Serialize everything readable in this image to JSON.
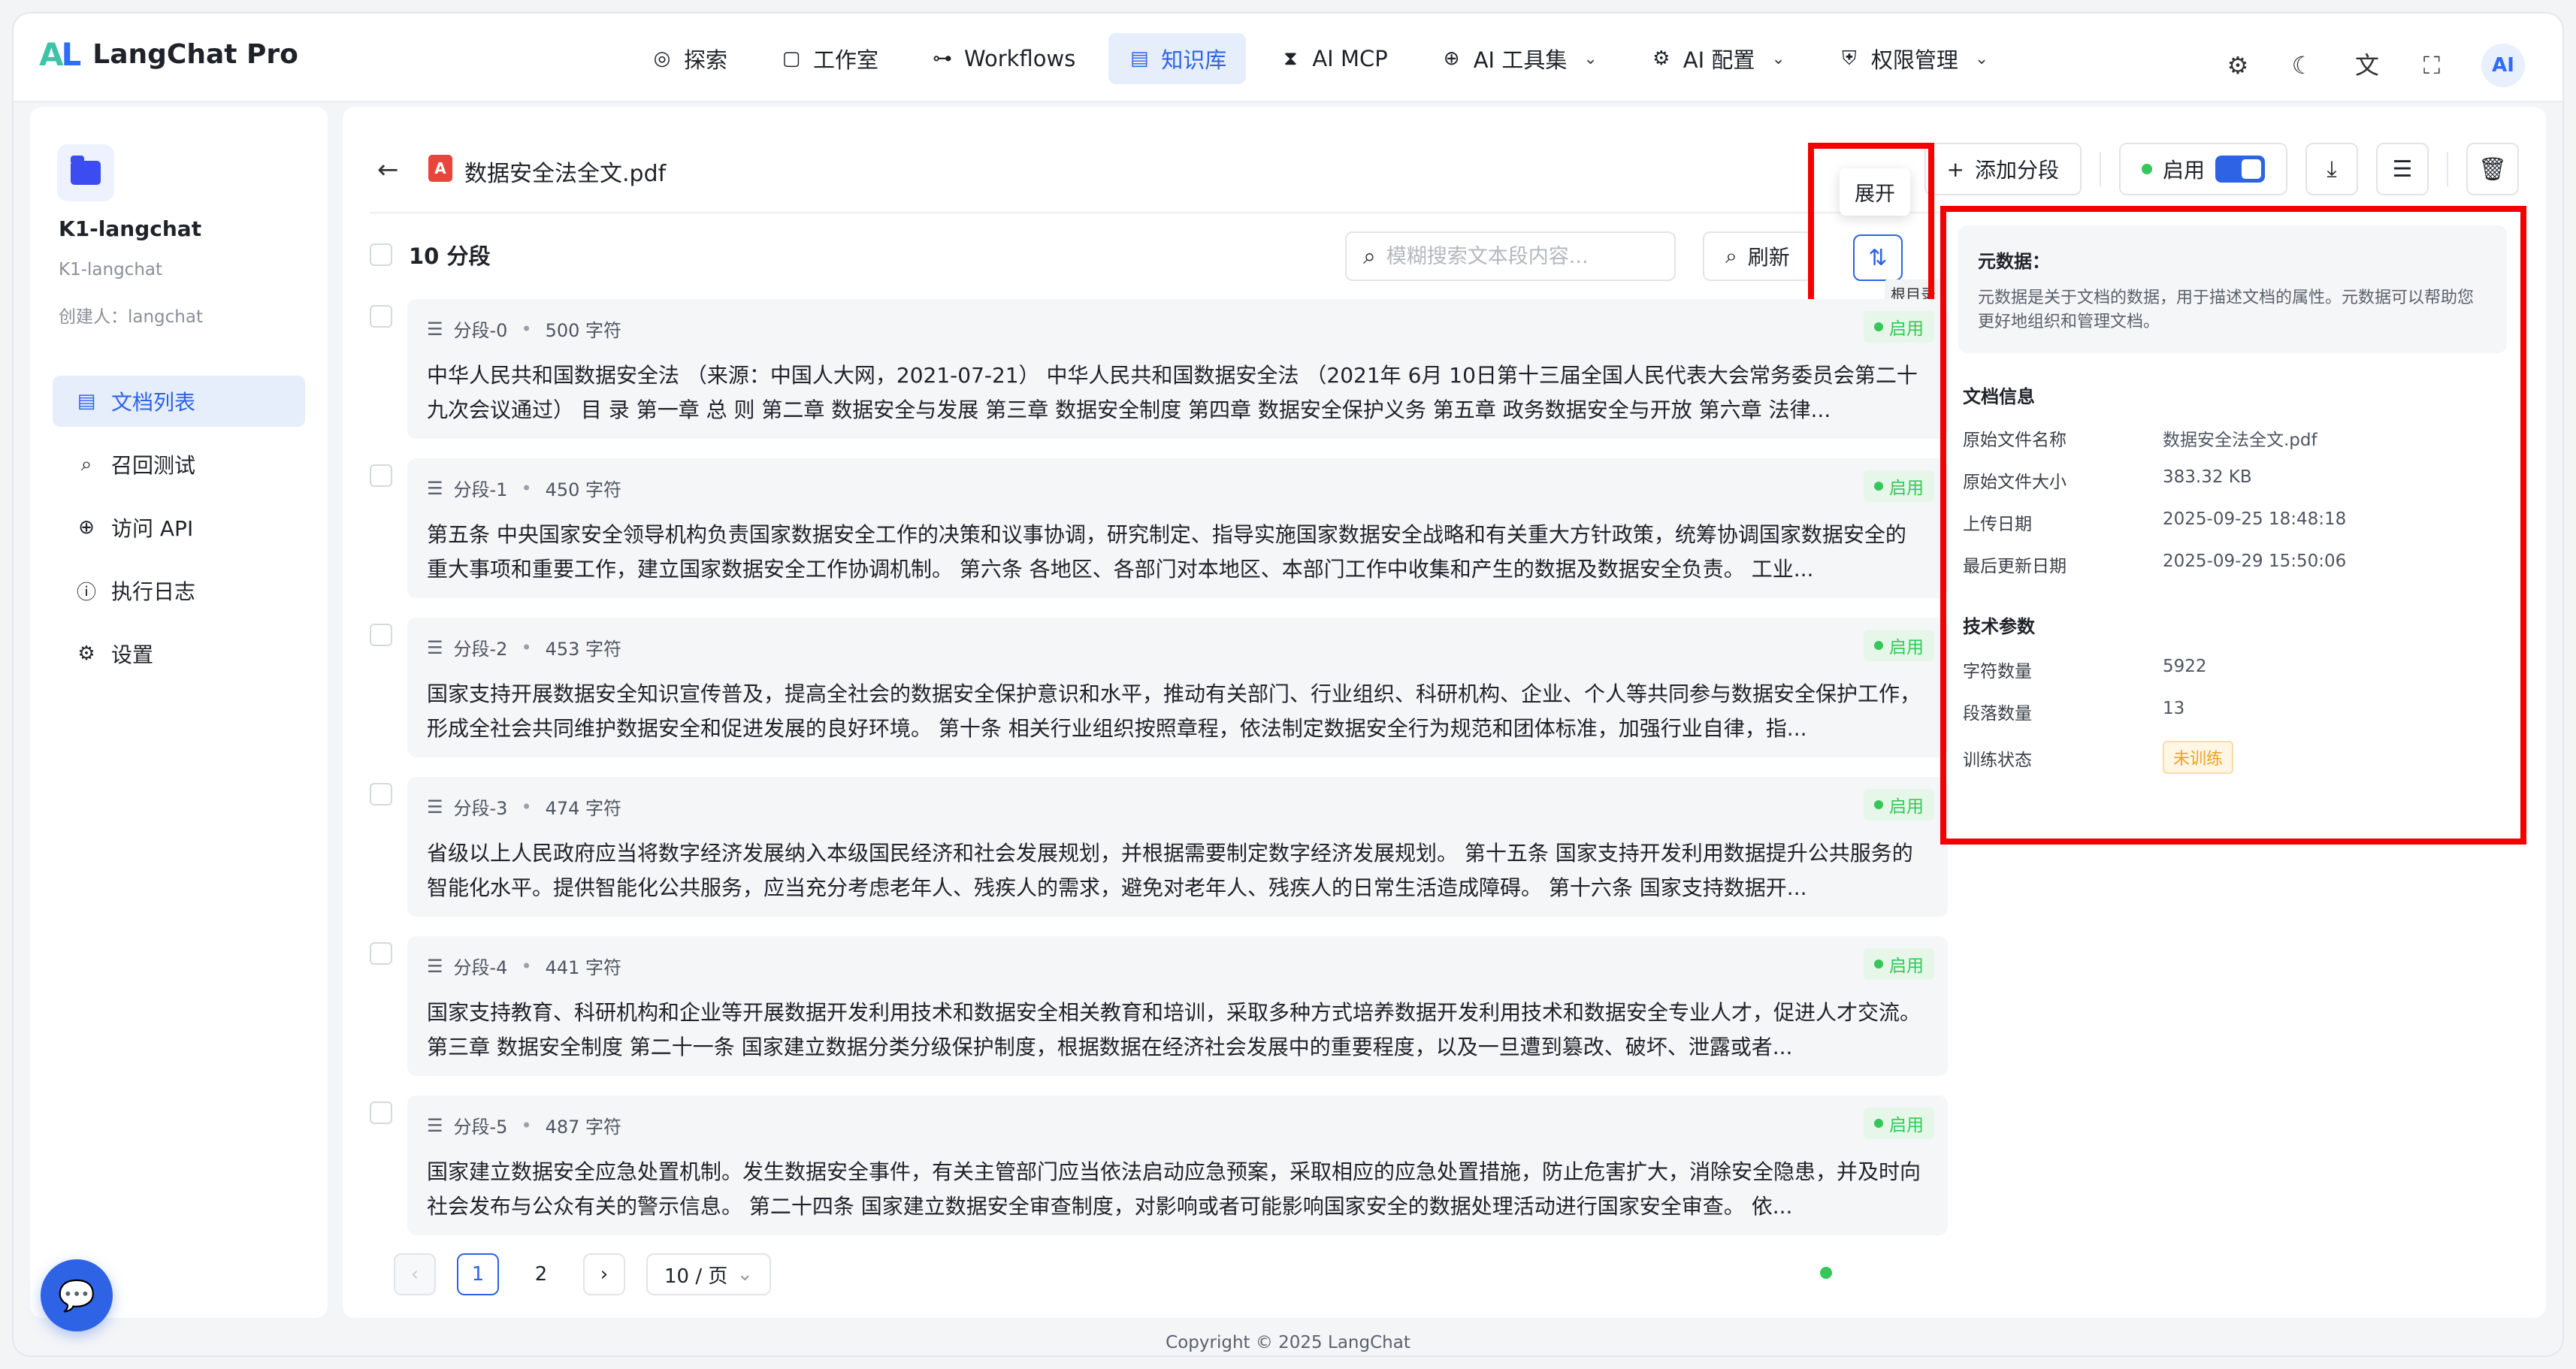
{
  "app": {
    "name": "LangChat Pro",
    "logo_a": "A",
    "logo_l": "L"
  },
  "nav": [
    {
      "icon": "◎",
      "label": "探索",
      "caret": ""
    },
    {
      "icon": "▢",
      "label": "工作室",
      "caret": ""
    },
    {
      "icon": "⊶",
      "label": "Workflows",
      "caret": ""
    },
    {
      "icon": "▤",
      "label": "知识库",
      "caret": ""
    },
    {
      "icon": "⧗",
      "label": "AI MCP",
      "caret": ""
    },
    {
      "icon": "⊕",
      "label": "AI 工具集",
      "caret": "⌄"
    },
    {
      "icon": "⚙",
      "label": "AI 配置",
      "caret": "⌄"
    },
    {
      "icon": "⛨",
      "label": "权限管理",
      "caret": "⌄"
    }
  ],
  "tools": {
    "settings": "⚙",
    "theme": "☾",
    "lang": "文",
    "fullscreen": "⛶",
    "avatar": "AI"
  },
  "kb": {
    "name": "K1-langchat",
    "sub": "K1-langchat",
    "creator": "创建人：langchat"
  },
  "side_menu": [
    {
      "icon": "▤",
      "label": "文档列表"
    },
    {
      "icon": "⌕",
      "label": "召回测试"
    },
    {
      "icon": "⊕",
      "label": "访问 API"
    },
    {
      "icon": "ⓘ",
      "label": "执行日志"
    },
    {
      "icon": "⚙",
      "label": "设置"
    }
  ],
  "doc": {
    "back": "←",
    "pdf_icon": "A",
    "title": "数据安全法全文.pdf",
    "add_segment": "添加分段",
    "add_icon": "+",
    "enable": "启用",
    "download_icon": "⤓",
    "settings_icon": "☰",
    "delete_icon": "🗑"
  },
  "toolbar": {
    "count": "10 分段",
    "search_placeholder": "模糊搜索文本段内容...",
    "search_icon": "⌕",
    "refresh": "刷新",
    "expand_icon": "⇅",
    "tooltip": "展开",
    "tooltip_small": "根目录"
  },
  "segments": [
    {
      "title": "分段-0",
      "chars": "500 字符",
      "status": "启用",
      "text": "中华人民共和国数据安全法 （来源：中国人大网，2021-07-21） 中华人民共和国数据安全法 （2021年 6月 10日第十三届全国人民代表大会常务委员会第二十九次会议通过） 目 录 第一章 总 则 第二章 数据安全与发展 第三章 数据安全制度 第四章 数据安全保护义务 第五章 政务数据安全与开放 第六章 法律..."
    },
    {
      "title": "分段-1",
      "chars": "450 字符",
      "status": "启用",
      "text": "第五条 中央国家安全领导机构负责国家数据安全工作的决策和议事协调，研究制定、指导实施国家数据安全战略和有关重大方针政策，统筹协调国家数据安全的重大事项和重要工作，建立国家数据安全工作协调机制。 第六条 各地区、各部门对本地区、本部门工作中收集和产生的数据及数据安全负责。 工业..."
    },
    {
      "title": "分段-2",
      "chars": "453 字符",
      "status": "启用",
      "text": "国家支持开展数据安全知识宣传普及，提高全社会的数据安全保护意识和水平，推动有关部门、行业组织、科研机构、企业、个人等共同参与数据安全保护工作，形成全社会共同维护数据安全和促进发展的良好环境。 第十条 相关行业组织按照章程，依法制定数据安全行为规范和团体标准，加强行业自律，指..."
    },
    {
      "title": "分段-3",
      "chars": "474 字符",
      "status": "启用",
      "text": "省级以上人民政府应当将数字经济发展纳入本级国民经济和社会发展规划，并根据需要制定数字经济发展规划。 第十五条 国家支持开发利用数据提升公共服务的智能化水平。提供智能化公共服务，应当充分考虑老年人、残疾人的需求，避免对老年人、残疾人的日常生活造成障碍。 第十六条 国家支持数据开..."
    },
    {
      "title": "分段-4",
      "chars": "441 字符",
      "status": "启用",
      "text": "国家支持教育、科研机构和企业等开展数据开发利用技术和数据安全相关教育和培训，采取多种方式培养数据开发利用技术和数据安全专业人才，促进人才交流。 第三章 数据安全制度 第二十一条 国家建立数据分类分级保护制度，根据数据在经济社会发展中的重要程度，以及一旦遭到篡改、破坏、泄露或者..."
    },
    {
      "title": "分段-5",
      "chars": "487 字符",
      "status": "启用",
      "text": "国家建立数据安全应急处置机制。发生数据安全事件，有关主管部门应当依法启动应急预案，采取相应的应急处置措施，防止危害扩大，消除安全隐患，并及时向社会发布与公众有关的警示信息。 第二十四条 国家建立数据安全审查制度，对影响或者可能影响国家安全的数据处理活动进行国家安全审查。 依..."
    }
  ],
  "pagination": {
    "prev": "‹",
    "next": "›",
    "page1": "1",
    "page2": "2",
    "size": "10 / 页",
    "size_caret": "⌄"
  },
  "meta": {
    "intro_title": "元数据：",
    "intro_text": "元数据是关于文档的数据，用于描述文档的属性。元数据可以帮助您更好地组织和管理文档。",
    "doc_info_title": "文档信息",
    "doc_info": [
      {
        "key": "原始文件名称",
        "value": "数据安全法全文.pdf"
      },
      {
        "key": "原始文件大小",
        "value": "383.32 KB"
      },
      {
        "key": "上传日期",
        "value": "2025-09-25 18:48:18"
      },
      {
        "key": "最后更新日期",
        "value": "2025-09-29 15:50:06"
      }
    ],
    "tech_title": "技术参数",
    "tech": [
      {
        "key": "字符数量",
        "value": "5922"
      },
      {
        "key": "段落数量",
        "value": "13"
      }
    ],
    "train_key": "训练状态",
    "train_value": "未训练"
  },
  "footer": {
    "copyright": "Copyright © 2025 LangChat",
    "chat_icon": "💬"
  }
}
